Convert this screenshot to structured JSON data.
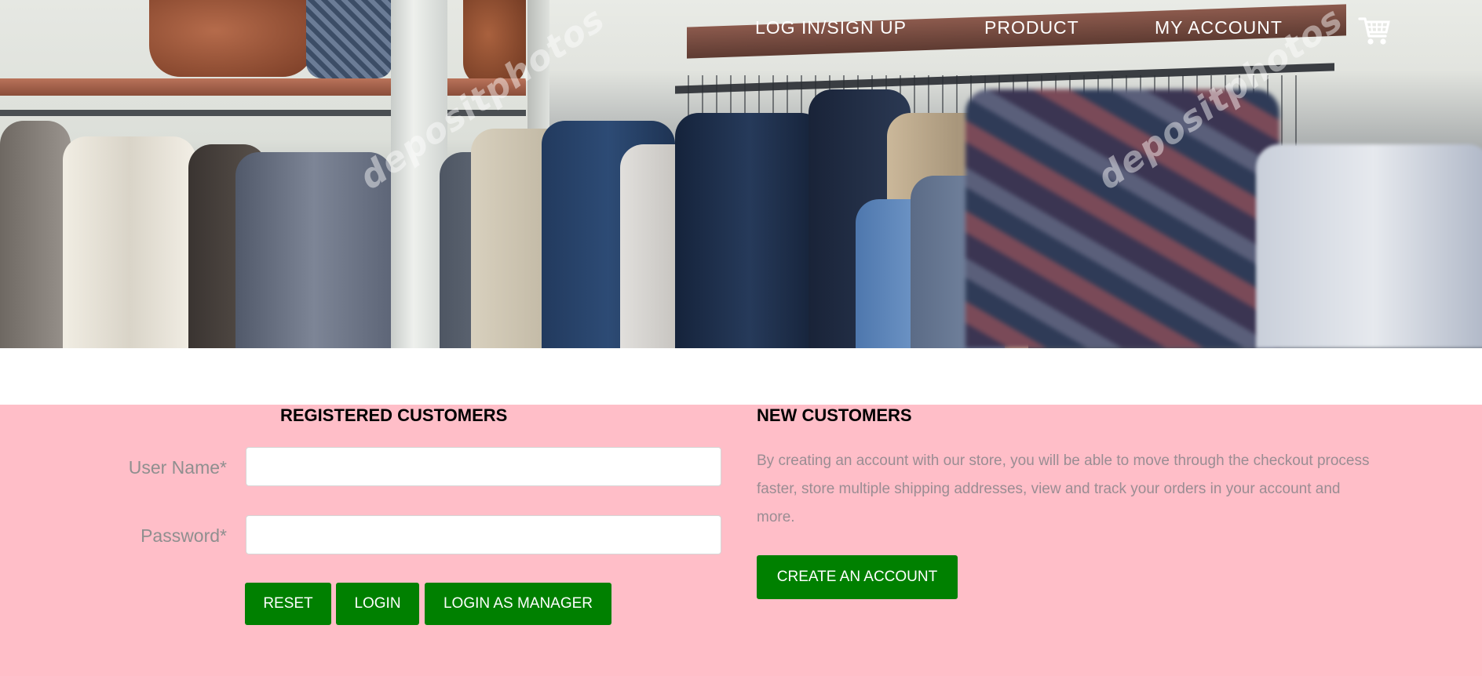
{
  "nav": {
    "login_signup": "LOG IN/SIGN UP",
    "product": "PRODUCT",
    "my_account": "MY ACCOUNT",
    "cart_icon": "shopping-cart-icon"
  },
  "hero": {
    "watermark_text": "depositphotos"
  },
  "registered": {
    "heading": "REGISTERED CUSTOMERS",
    "username_label": "User Name*",
    "username_value": "",
    "password_label": "Password*",
    "password_value": "",
    "reset_label": "RESET",
    "login_label": "LOGIN",
    "manager_label": "LOGIN AS MANAGER"
  },
  "new_customers": {
    "heading": "NEW CUSTOMERS",
    "description": "By creating an account with our store, you will be able to move through the checkout process faster, store multiple shipping addresses, view and track your orders in your account and more.",
    "create_label": "CREATE AN ACCOUNT"
  },
  "colors": {
    "panel_bg": "#ffbec8",
    "button_bg": "#008000",
    "label_text": "#8f8f8f"
  }
}
